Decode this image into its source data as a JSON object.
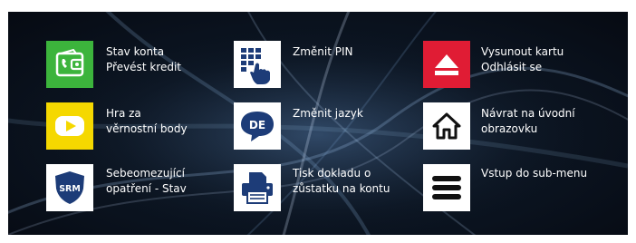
{
  "menu": {
    "items": [
      {
        "line1": "Stav konta",
        "line2": "Převést kredit",
        "icon": "wallet-icon",
        "color": "#3cb43c"
      },
      {
        "line1": "Změnit PIN",
        "line2": "",
        "icon": "keypad-icon",
        "color": "#ffffff"
      },
      {
        "line1": "Vysunout kartu",
        "line2": "Odhlásit se",
        "icon": "eject-icon",
        "color": "#e01c34"
      },
      {
        "line1": "Hra za",
        "line2": "věrnostní body",
        "icon": "play-icon",
        "color": "#f5d800"
      },
      {
        "line1": "Změnit jazyk",
        "line2": "",
        "icon": "language-icon",
        "color": "#ffffff",
        "badge": "DE"
      },
      {
        "line1": "Návrat na úvodní",
        "line2": "obrazovku",
        "icon": "home-icon",
        "color": "#ffffff"
      },
      {
        "line1": "Sebeomezující",
        "line2": "opatření - Stav",
        "icon": "shield-icon",
        "color": "#ffffff",
        "badge": "SRM"
      },
      {
        "line1": "Tisk dokladu o",
        "line2": "zůstatku na kontu",
        "icon": "printer-icon",
        "color": "#ffffff"
      },
      {
        "line1": "Vstup do sub-menu",
        "line2": "",
        "icon": "hamburger-menu-icon",
        "color": "#ffffff"
      }
    ]
  },
  "colors": {
    "icon_dark": "#1d3c78",
    "background": "#0c1624"
  }
}
